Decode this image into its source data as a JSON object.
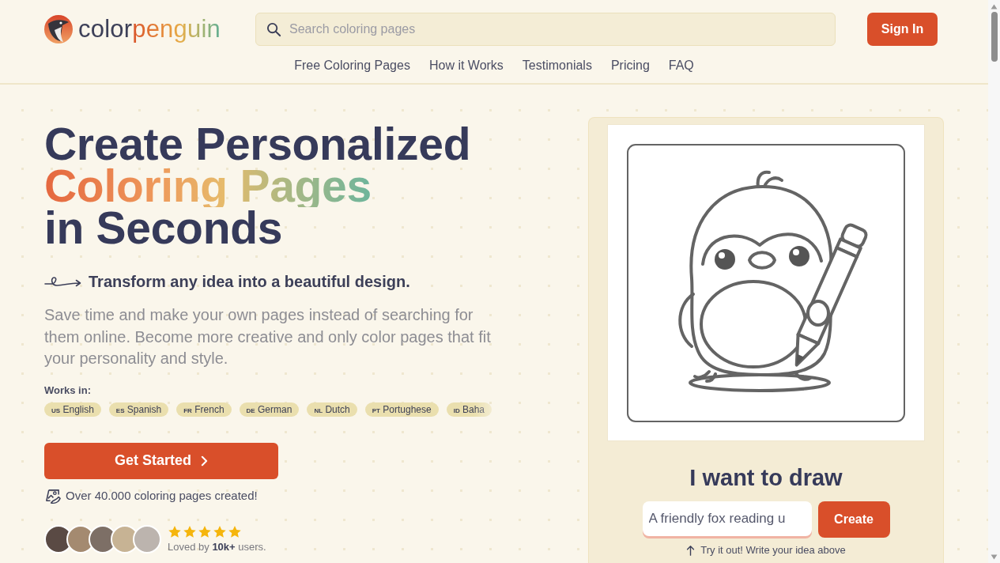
{
  "header": {
    "logo": {
      "parts": [
        "color",
        "penguin"
      ]
    },
    "search": {
      "placeholder": "Search coloring pages"
    },
    "sign_in": "Sign In",
    "nav_links": [
      "Free Coloring Pages",
      "How it Works",
      "Testimonials",
      "Pricing",
      "FAQ"
    ]
  },
  "hero": {
    "title_lines": [
      {
        "text": "Create Personalized",
        "kind": "plain"
      },
      {
        "text": "Coloring Pages",
        "kind": "gradient"
      },
      {
        "text": "in Seconds",
        "kind": "plain"
      }
    ],
    "tagline": "Transform any idea into a beautiful design.",
    "description": "Save time and make your own pages instead of searching for them online. Become more creative and only color pages that fit your personality and style.",
    "works_in_label": "Works in:",
    "languages": [
      {
        "code": "US",
        "name": "English"
      },
      {
        "code": "ES",
        "name": "Spanish"
      },
      {
        "code": "FR",
        "name": "French"
      },
      {
        "code": "DE",
        "name": "German"
      },
      {
        "code": "NL",
        "name": "Dutch"
      },
      {
        "code": "PT",
        "name": "Portughese"
      },
      {
        "code": "ID",
        "name": "Baha"
      }
    ],
    "cta": "Get Started",
    "pages_created": "Over 40.000 coloring pages created!",
    "rating": {
      "stars": 5,
      "caption": "Loved by **10k+** users."
    }
  },
  "generator": {
    "heading": "I want to draw",
    "input_value": "A friendly fox reading u",
    "create_button": "Create",
    "hint": "Try it out! Write your idea above"
  }
}
